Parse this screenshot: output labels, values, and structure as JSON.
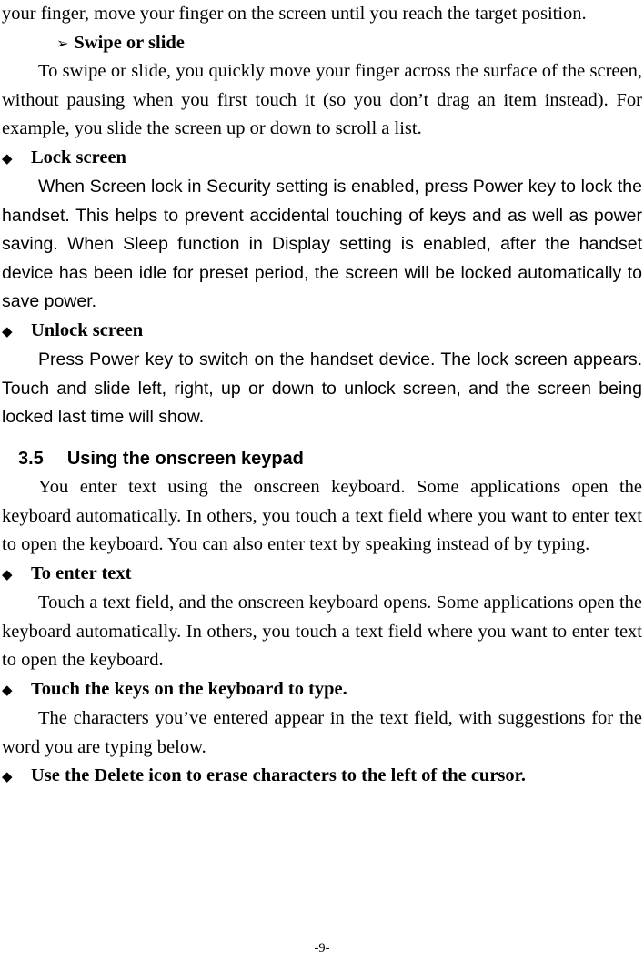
{
  "document": {
    "paragraphs": {
      "p_touch_drag_cont": "your finger, move your finger on the screen until you reach the target position.",
      "h_swipe_or_slide": "Swipe or slide",
      "p_swipe": "To swipe or slide, you quickly move your finger across the surface of the screen, without pausing when you first touch it (so you don’t drag an item instead). For example, you slide the screen up or down to scroll a list.",
      "h_lock_screen": "Lock screen",
      "p_lock": "When Screen lock in Security setting is enabled, press Power key to lock the handset. This helps to prevent accidental touching of keys and as well as power saving.    When Sleep function in Display setting is enabled, after the handset device has been idle for preset period, the screen will be locked automatically to save power.",
      "h_unlock_screen": "Unlock screen",
      "p_unlock": "Press Power key to switch on the handset device. The lock screen appears. Touch and slide left, right, up or down to unlock screen, and the screen being locked last time will show.",
      "section_number": "3.5",
      "section_title": "Using the onscreen keypad",
      "p_keyboard_intro": "You enter text using the onscreen keyboard. Some applications open the keyboard automatically. In others, you touch a text field where you want to enter text to open the keyboard. You can also enter text by speaking instead of by typing.",
      "h_to_enter_text": "To enter text",
      "p_to_enter_text": "Touch a text field, and the onscreen keyboard opens. Some applications open the keyboard automatically. In others, you touch a text field where you want to enter text to open the keyboard.",
      "h_touch_keys": "Touch the keys on the keyboard to type.",
      "p_touch_keys": "The characters you’ve entered appear in the text field, with suggestions for the word you are typing below.",
      "h_use_delete": "Use the Delete icon to erase characters to the left of the cursor."
    },
    "bullets": {
      "arrow": "➢",
      "diamond": "◆"
    },
    "footer": "-9-"
  }
}
